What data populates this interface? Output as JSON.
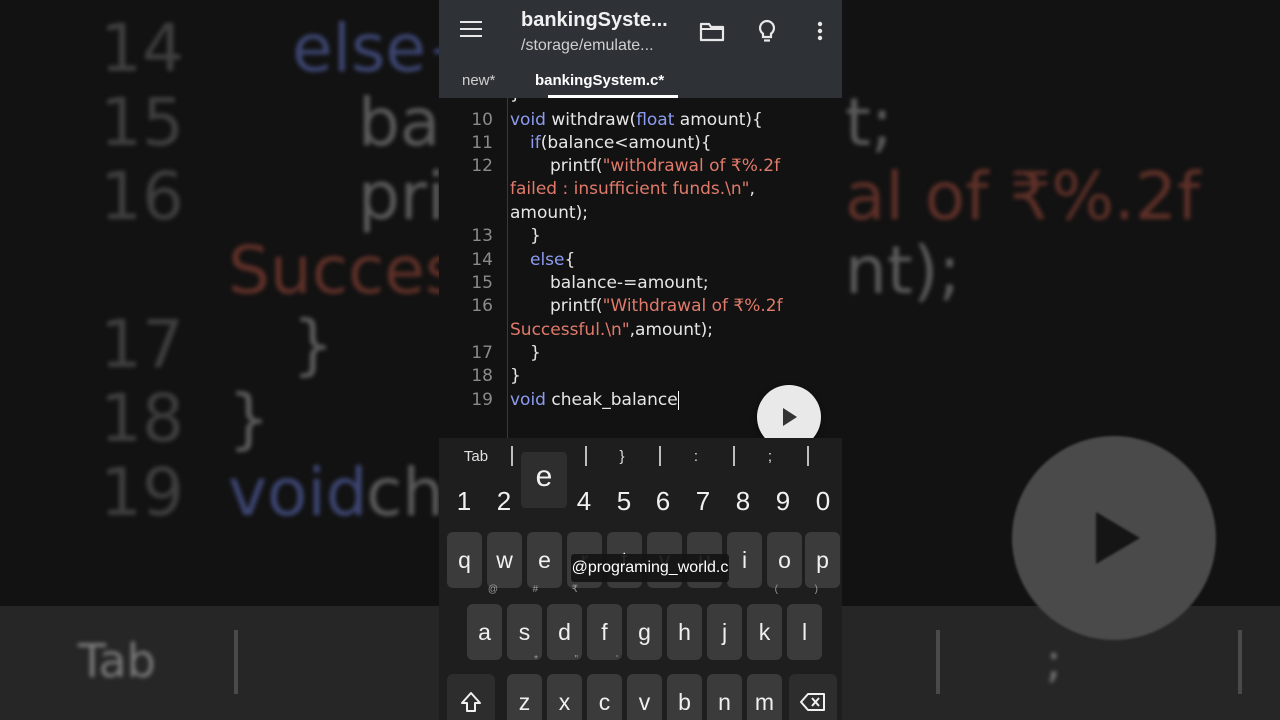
{
  "app": {
    "title": "bankingSyste...",
    "subtitle": "/storage/emulate..."
  },
  "icons": [
    "menu-icon",
    "folder-icon",
    "lightbulb-icon",
    "more-vert-icon",
    "play-icon",
    "shift-icon",
    "backspace-icon"
  ],
  "tabs": [
    {
      "label": "new*"
    },
    {
      "label": "bankingSystem.c*"
    }
  ],
  "editor": {
    "line_numbers": [
      "10",
      "11",
      "12",
      "13",
      "14",
      "15",
      "16",
      "17",
      "18",
      "19"
    ],
    "lines": {
      "l9": "}",
      "l10a": "void",
      "l10b": " withdraw(",
      "l10c": "float",
      "l10d": " amount){",
      "l11a": "if",
      "l11b": "(balance<amount){",
      "l12a": "printf(",
      "l12b": "\"withdrawal of ₹%.2f",
      "l12c": "failed : insufficient funds.\\n\"",
      "l12d": ",",
      "l12e": "amount);",
      "l13": "}",
      "l14a": "else",
      "l14b": "{",
      "l15": "balance-=amount;",
      "l16a": "printf(",
      "l16b": "\"Withdrawal of ₹%.2f",
      "l16c": "Successful.\\n\"",
      "l16d": ",amount);",
      "l17": "}",
      "l18": "}",
      "l19a": "void",
      "l19b": " cheak_balance"
    }
  },
  "keyboard": {
    "extra_keys": [
      "Tab",
      "e",
      "}",
      ":",
      ";"
    ],
    "popup_key": "e",
    "numbers": [
      "1",
      "2",
      "3",
      "4",
      "5",
      "6",
      "7",
      "8",
      "9",
      "0"
    ],
    "row1": [
      "q",
      "w",
      "e",
      "r",
      "t",
      "y",
      "u",
      "i",
      "o",
      "p"
    ],
    "row2": [
      "a",
      "s",
      "d",
      "f",
      "g",
      "h",
      "j",
      "k",
      "l"
    ],
    "row2_hints": [
      "@",
      "#",
      "₹",
      "",
      "",
      "",
      "",
      "(",
      ")"
    ],
    "row3": [
      "z",
      "x",
      "c",
      "v",
      "b",
      "n",
      "m"
    ],
    "row3_hints": [
      "*",
      "\"",
      "'",
      "",
      "",
      "",
      "",
      ""
    ]
  },
  "watermark": "@programing_world.c",
  "background": {
    "nums": [
      "14",
      "15",
      "16",
      "17",
      "18",
      "19"
    ],
    "t_else": "else{",
    "t_bal": "bal",
    "t_t": "t;",
    "t_pri": "pri",
    "t_alof": "al of ₹%.2f",
    "t_succ": "Success",
    "t_nt": "nt);",
    "t_brace1": "}",
    "t_brace2": "}",
    "t_void": "void",
    "t_ch": "ch",
    "t_tab": "Tab",
    "t_semi": ";"
  },
  "colors": {
    "appbar": "#2e3236",
    "editor_bg": "#121212",
    "keyword": "#8c9cf0",
    "string": "#e07a6a"
  }
}
